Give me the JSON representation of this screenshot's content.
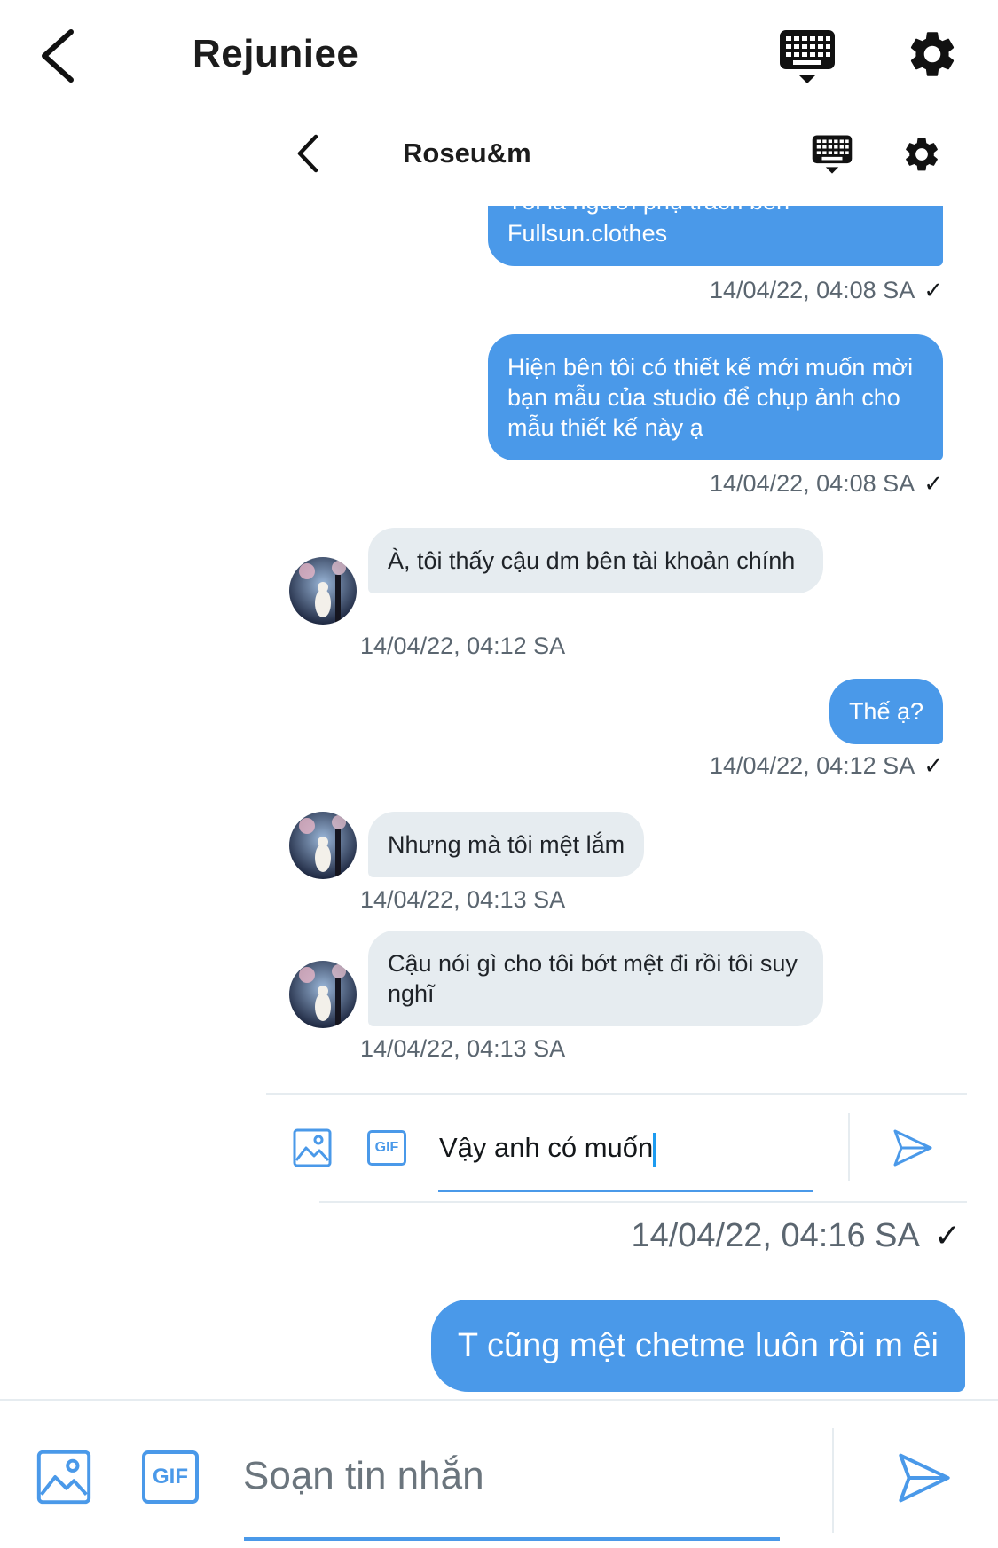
{
  "outer": {
    "title": "Rejuniee",
    "icons": {
      "back": "chevron-left-icon",
      "keyboard": "keyboard-icon",
      "settings": "gear-icon"
    }
  },
  "inner": {
    "title": "Roseu&m",
    "icons": {
      "back": "chevron-left-icon",
      "keyboard": "keyboard-icon",
      "settings": "gear-icon"
    },
    "messages": [
      {
        "direction": "out",
        "partial_text": "Tôi là người phụ trách bên",
        "text": "Fullsun.clothes",
        "timestamp": "14/04/22, 04:08 SA",
        "read": true
      },
      {
        "direction": "out",
        "text": "Hiện bên tôi có thiết kế mới muốn mời bạn mẫu của studio để chụp ảnh cho mẫu thiết kế này ạ",
        "timestamp": "14/04/22, 04:08 SA",
        "read": true
      },
      {
        "direction": "in",
        "text": "À, tôi thấy cậu dm bên tài khoản chính",
        "timestamp": "14/04/22, 04:12 SA"
      },
      {
        "direction": "out",
        "text": "Thế ạ?",
        "timestamp": "14/04/22, 04:12 SA",
        "read": true
      },
      {
        "direction": "in",
        "text": "Nhưng mà tôi mệt lắm",
        "timestamp": "14/04/22, 04:13 SA"
      },
      {
        "direction": "in",
        "text": "Cậu nói gì cho tôi bớt mệt đi rồi tôi suy nghĩ",
        "timestamp": "14/04/22, 04:13 SA"
      }
    ],
    "composer": {
      "value": "Vậy anh có muốn",
      "gif_label": "GIF"
    }
  },
  "outer_messages": [
    {
      "direction": "out",
      "text": "T cũng mệt chetme luôn rồi m êi",
      "timestamp": "14/04/22, 04:16 SA",
      "read": true
    }
  ],
  "composer": {
    "placeholder": "Soạn tin nhắn",
    "gif_label": "GIF"
  },
  "check_glyph": "✓",
  "colors": {
    "accent": "#4a99e9",
    "incoming_bubble": "#e6ecf0",
    "timestamp": "#5b6670"
  }
}
